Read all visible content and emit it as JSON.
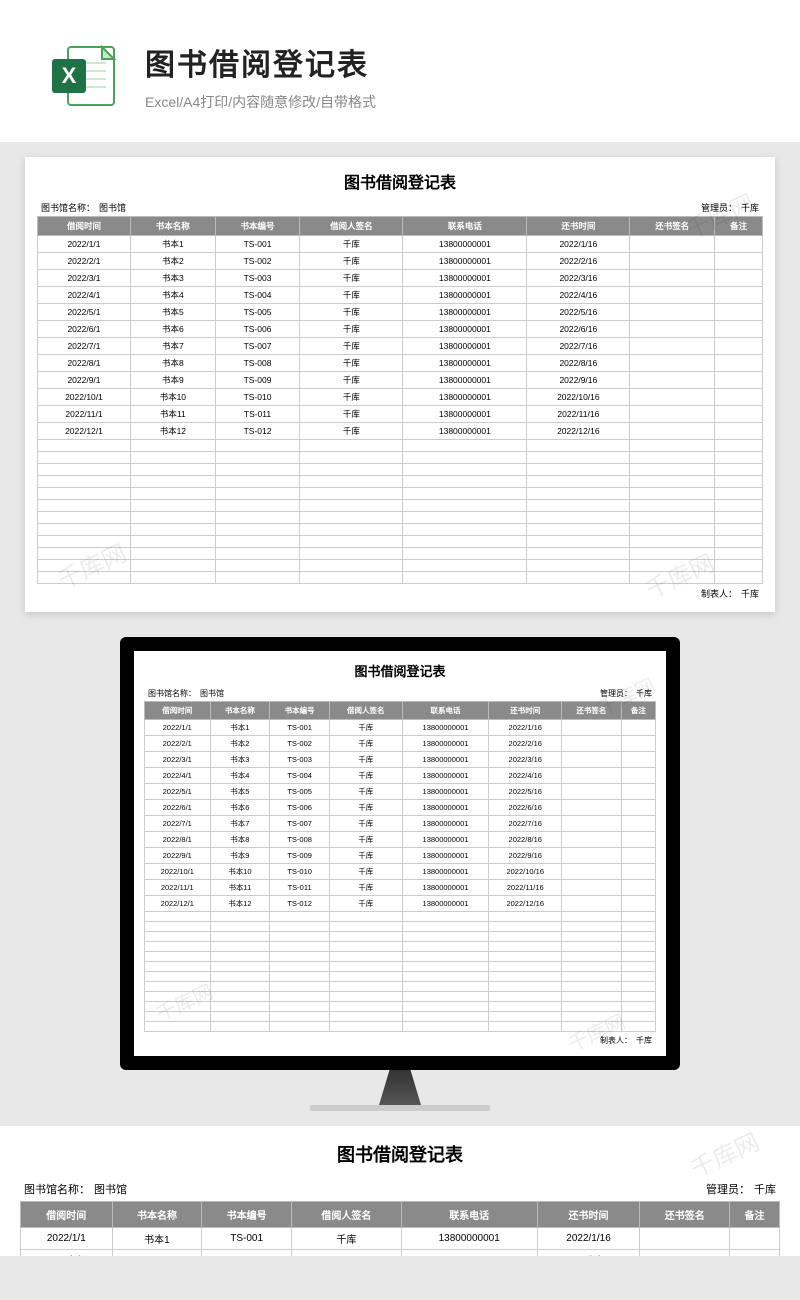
{
  "header": {
    "title": "图书借阅登记表",
    "subtitle": "Excel/A4打印/内容随意修改/自带格式"
  },
  "sheet": {
    "title": "图书借阅登记表",
    "library_label": "图书馆名称：",
    "library_name": "图书馆",
    "manager_label": "管理员：",
    "manager_name": "千库",
    "columns": [
      "借阅时间",
      "书本名称",
      "书本编号",
      "借阅人签名",
      "联系电话",
      "还书时间",
      "还书签名",
      "备注"
    ],
    "rows": [
      {
        "c": [
          "2022/1/1",
          "书本1",
          "TS-001",
          "千库",
          "13800000001",
          "2022/1/16",
          "",
          ""
        ]
      },
      {
        "c": [
          "2022/2/1",
          "书本2",
          "TS-002",
          "千库",
          "13800000001",
          "2022/2/16",
          "",
          ""
        ]
      },
      {
        "c": [
          "2022/3/1",
          "书本3",
          "TS-003",
          "千库",
          "13800000001",
          "2022/3/16",
          "",
          ""
        ]
      },
      {
        "c": [
          "2022/4/1",
          "书本4",
          "TS-004",
          "千库",
          "13800000001",
          "2022/4/16",
          "",
          ""
        ]
      },
      {
        "c": [
          "2022/5/1",
          "书本5",
          "TS-005",
          "千库",
          "13800000001",
          "2022/5/16",
          "",
          ""
        ]
      },
      {
        "c": [
          "2022/6/1",
          "书本6",
          "TS-006",
          "千库",
          "13800000001",
          "2022/6/16",
          "",
          ""
        ]
      },
      {
        "c": [
          "2022/7/1",
          "书本7",
          "TS-007",
          "千库",
          "13800000001",
          "2022/7/16",
          "",
          ""
        ]
      },
      {
        "c": [
          "2022/8/1",
          "书本8",
          "TS-008",
          "千库",
          "13800000001",
          "2022/8/16",
          "",
          ""
        ]
      },
      {
        "c": [
          "2022/9/1",
          "书本9",
          "TS-009",
          "千库",
          "13800000001",
          "2022/9/16",
          "",
          ""
        ]
      },
      {
        "c": [
          "2022/10/1",
          "书本10",
          "TS-010",
          "千库",
          "13800000001",
          "2022/10/16",
          "",
          ""
        ]
      },
      {
        "c": [
          "2022/11/1",
          "书本11",
          "TS-011",
          "千库",
          "13800000001",
          "2022/11/16",
          "",
          ""
        ]
      },
      {
        "c": [
          "2022/12/1",
          "书本12",
          "TS-012",
          "千库",
          "13800000001",
          "2022/12/16",
          "",
          ""
        ]
      }
    ],
    "empty_rows": 12,
    "footer_label": "制表人：",
    "footer_name": "千库"
  },
  "watermark_text": "千库网",
  "bottom_preview_rows": 3
}
